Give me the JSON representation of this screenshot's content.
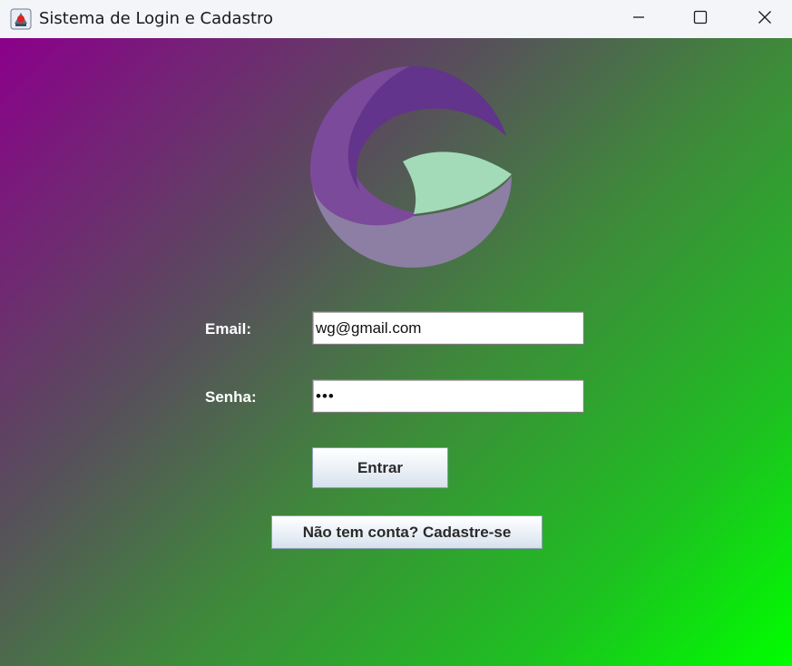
{
  "window": {
    "title": "Sistema de Login e Cadastro",
    "app_icon": "java-app-icon",
    "controls": {
      "minimize_icon": "minimize-icon",
      "maximize_icon": "maximize-icon",
      "close_icon": "close-icon"
    }
  },
  "logo": {
    "icon": "logo-icon",
    "colors": {
      "dark_purple": "#6a3592",
      "mid_purple": "#7b4a9a",
      "grey_purple": "#8d7ea3",
      "mint": "#a3dbb9"
    }
  },
  "form": {
    "email_label": "Email:",
    "email_value": "wg@gmail.com",
    "senha_label": "Senha:",
    "senha_value": "•••",
    "entrar_label": "Entrar",
    "cadastro_label": "Não tem conta? Cadastre-se"
  },
  "colors": {
    "gradient_start": "#8b008b",
    "gradient_end": "#00ff00",
    "label_text": "#ffffff"
  }
}
